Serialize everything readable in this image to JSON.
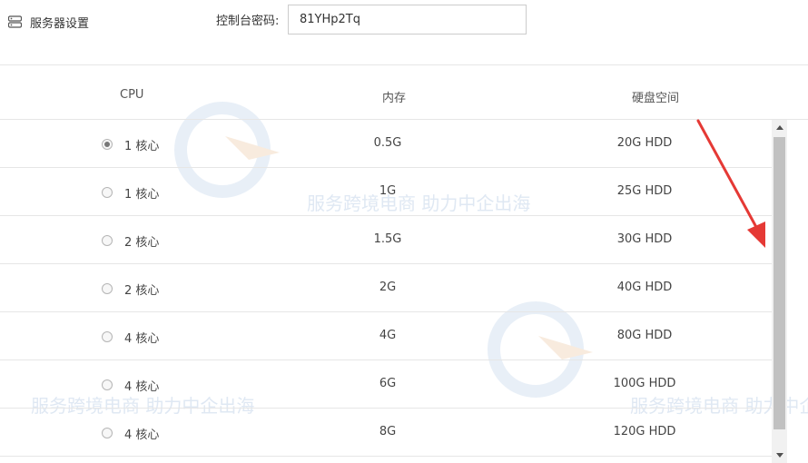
{
  "header": {
    "section_title": "服务器设置",
    "password_label": "控制台密码:",
    "password_value": "81YHp2Tq"
  },
  "table": {
    "columns": [
      "CPU",
      "内存",
      "硬盘空间"
    ],
    "rows": [
      {
        "cpu": "1 核心",
        "memory": "0.5G",
        "disk": "20G HDD",
        "selected": true
      },
      {
        "cpu": "1 核心",
        "memory": "1G",
        "disk": "25G HDD",
        "selected": false
      },
      {
        "cpu": "2 核心",
        "memory": "1.5G",
        "disk": "30G HDD",
        "selected": false
      },
      {
        "cpu": "2 核心",
        "memory": "2G",
        "disk": "40G HDD",
        "selected": false
      },
      {
        "cpu": "4 核心",
        "memory": "4G",
        "disk": "80G HDD",
        "selected": false
      },
      {
        "cpu": "4 核心",
        "memory": "6G",
        "disk": "100G HDD",
        "selected": false
      },
      {
        "cpu": "4 核心",
        "memory": "8G",
        "disk": "120G HDD",
        "selected": false
      }
    ]
  },
  "watermark": {
    "tagline": "服务跨境电商 助力中企出海"
  },
  "colors": {
    "border": "#e6e6e6",
    "annotation_arrow": "#e53935",
    "watermark": "#dbe6f2"
  }
}
